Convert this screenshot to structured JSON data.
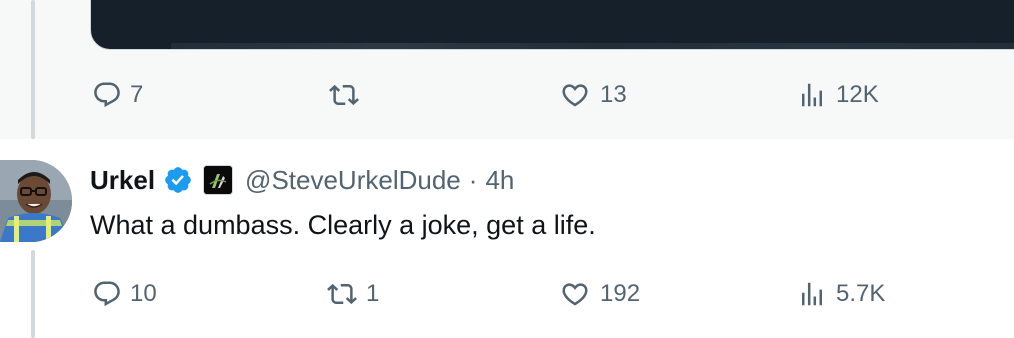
{
  "colors": {
    "text_primary": "#0f1419",
    "text_secondary": "#536471",
    "verified_blue": "#1d9bf0",
    "thread_line": "#cfd9de"
  },
  "previous_tweet": {
    "actions": {
      "replies": "7",
      "retweets": "",
      "likes": "13",
      "views": "12K"
    }
  },
  "reply": {
    "display_name": "Urkel",
    "verified": true,
    "handle": "@SteveUrkelDude",
    "separator": "·",
    "time": "4h",
    "text": "What a dumbass. Clearly a joke, get a life.",
    "actions": {
      "replies": "10",
      "retweets": "1",
      "likes": "192",
      "views": "5.7K"
    }
  },
  "icons": {
    "reply": "reply-icon",
    "retweet": "retweet-icon",
    "like": "heart-icon",
    "views": "analytics-icon",
    "verified": "verified-badge-icon",
    "affiliate": "affiliate-badge-icon"
  }
}
